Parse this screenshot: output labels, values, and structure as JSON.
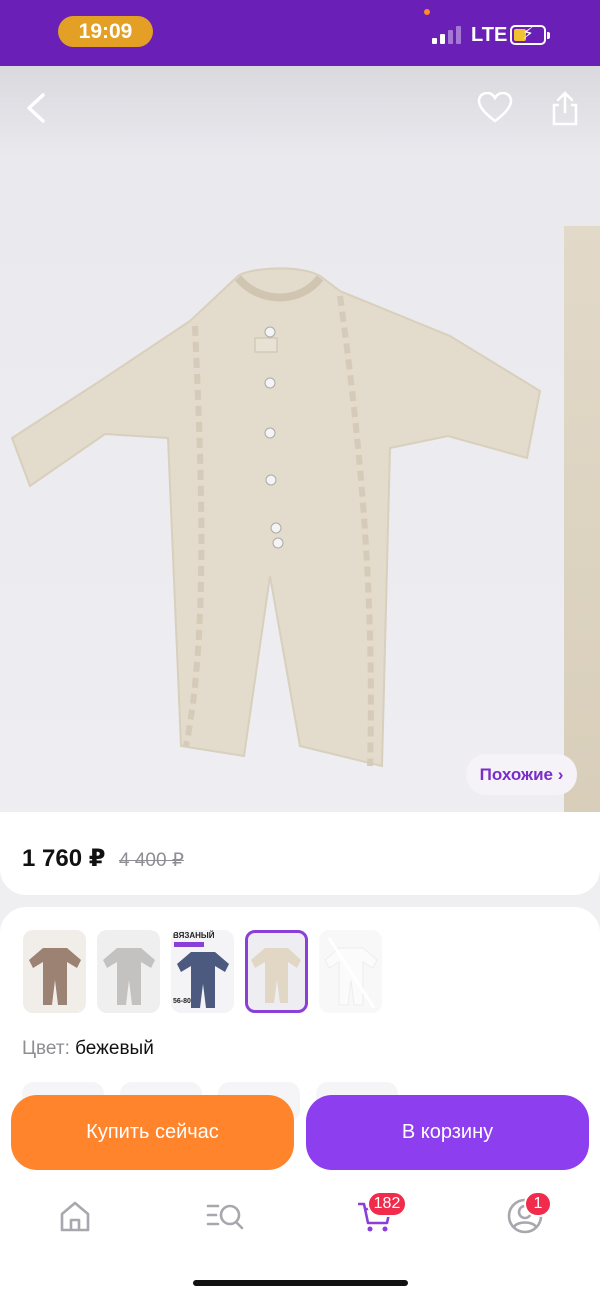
{
  "status_bar": {
    "time": "19:09",
    "network": "LTE"
  },
  "product": {
    "price_current": "1 760 ₽",
    "price_old": "4 400 ₽",
    "similar_label": "Похожие ›"
  },
  "variants": {
    "thumbnails": [
      {
        "color": "#9c8272"
      },
      {
        "color": "#c4c2c0"
      },
      {
        "color": "#4d5a80",
        "text_top": "ВЯЗАНЫЙ",
        "text_size": "56-80"
      },
      {
        "color": "#e2d7c4"
      },
      {
        "color": "#f1f1f3"
      }
    ],
    "color_label": "Цвет:",
    "color_value": "бежевый"
  },
  "actions": {
    "buy_now": "Купить сейчас",
    "add_to_cart": "В корзину"
  },
  "nav": {
    "cart_badge": "182",
    "profile_badge": "1"
  },
  "colors": {
    "brand": "#6a1fb7",
    "buy": "#ff842b",
    "cart": "#8d3ff0",
    "badge": "#f02b4c"
  }
}
